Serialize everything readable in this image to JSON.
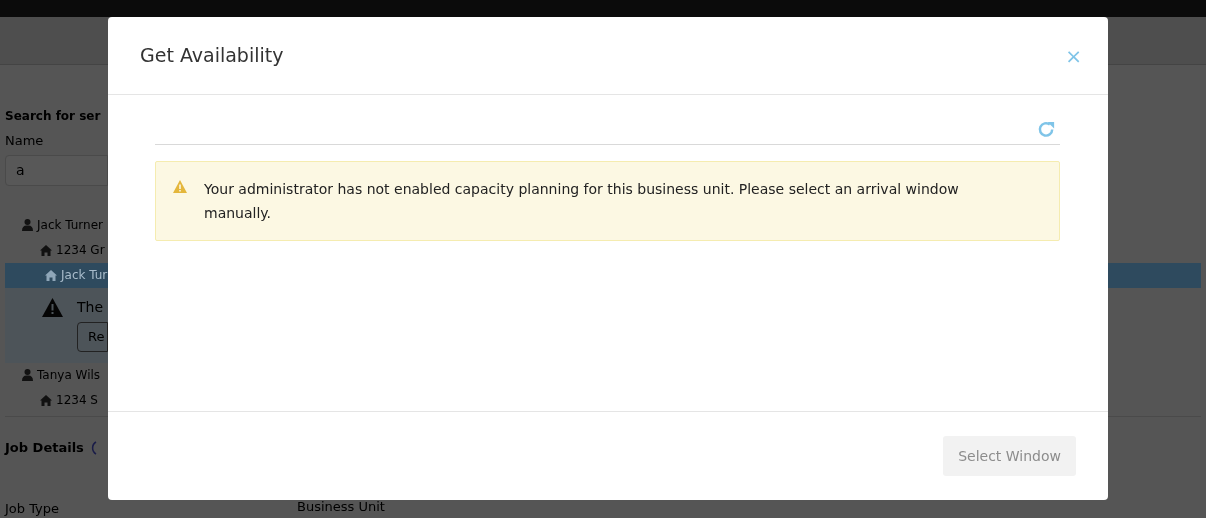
{
  "background": {
    "search_heading": "Search for ser",
    "name_label": "Name",
    "name_value": "a",
    "results": [
      {
        "kind": "customer",
        "text": "Jack Turner",
        "selected": false
      },
      {
        "kind": "location",
        "text": "1234 Gr",
        "selected": false
      },
      {
        "kind": "location",
        "text": "Jack Tur",
        "selected": true
      },
      {
        "kind": "warning",
        "text": "The",
        "button": "Re"
      },
      {
        "kind": "customer",
        "text": "Tanya Wils",
        "selected": false
      },
      {
        "kind": "location",
        "text": "1234 S",
        "selected": false
      }
    ],
    "job_details": "Job Details",
    "job_type_label": "Job Type",
    "business_unit_label": "Business Unit"
  },
  "modal": {
    "title": "Get Availability",
    "close": "×",
    "alert": "Your administrator has not enabled capacity planning for this business unit. Please select an arrival window manually.",
    "select_button": {
      "label": "Select Window",
      "disabled": true
    }
  }
}
